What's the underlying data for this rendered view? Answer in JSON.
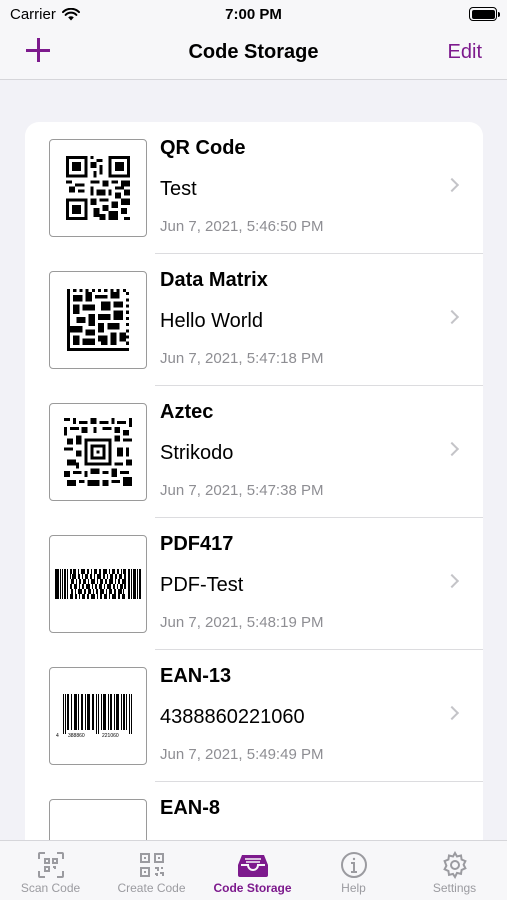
{
  "status_bar": {
    "carrier": "Carrier",
    "time": "7:00 PM"
  },
  "nav": {
    "title": "Code Storage",
    "edit_label": "Edit"
  },
  "codes": [
    {
      "type": "QR Code",
      "content": "Test",
      "date": "Jun 7, 2021, 5:46:50 PM"
    },
    {
      "type": "Data Matrix",
      "content": "Hello World",
      "date": "Jun 7, 2021, 5:47:18 PM"
    },
    {
      "type": "Aztec",
      "content": "Strikodo",
      "date": "Jun 7, 2021, 5:47:38 PM"
    },
    {
      "type": "PDF417",
      "content": "PDF-Test",
      "date": "Jun 7, 2021, 5:48:19 PM"
    },
    {
      "type": "EAN-13",
      "content": "4388860221060",
      "date": "Jun 7, 2021, 5:49:49 PM"
    },
    {
      "type": "EAN-8",
      "content": "",
      "date": ""
    }
  ],
  "tabs": [
    {
      "label": "Scan Code",
      "icon": "scan-code-icon"
    },
    {
      "label": "Create Code",
      "icon": "qr-code-icon"
    },
    {
      "label": "Code Storage",
      "icon": "tray-icon",
      "active": true
    },
    {
      "label": "Help",
      "icon": "info-icon"
    },
    {
      "label": "Settings",
      "icon": "gear-icon"
    }
  ],
  "colors": {
    "accent": "#7d1a8d",
    "inactive": "#9b9ba0",
    "background": "#f2f2f7"
  }
}
